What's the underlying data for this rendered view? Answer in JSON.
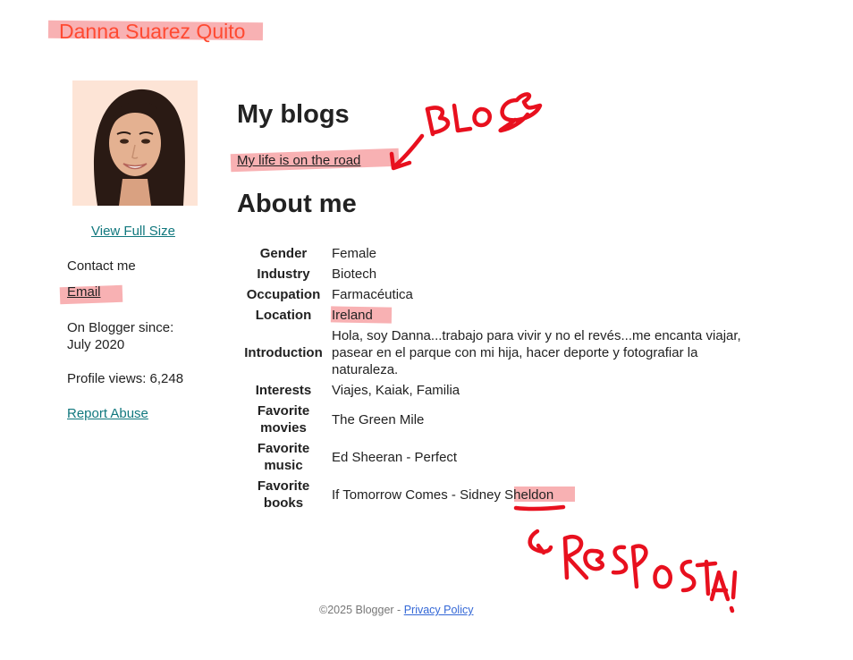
{
  "profile": {
    "name": "Danna Suarez Quito",
    "view_full_size": "View Full Size",
    "contact_label": "Contact me",
    "email_link": "Email",
    "blogger_since_line1": "On Blogger since:",
    "blogger_since_line2": "July 2020",
    "profile_views": "Profile views: 6,248",
    "report_abuse": "Report Abuse"
  },
  "blogs": {
    "heading": "My blogs",
    "items": [
      {
        "title": "My life is on the road"
      }
    ]
  },
  "about": {
    "heading": "About me",
    "rows": [
      {
        "label": "Gender",
        "value": "Female"
      },
      {
        "label": "Industry",
        "value": "Biotech"
      },
      {
        "label": "Occupation",
        "value": "Farmacéutica"
      },
      {
        "label": "Location",
        "value": "Ireland"
      },
      {
        "label": "Introduction",
        "value": "Hola, soy Danna...trabajo para vivir y no el revés...me encanta viajar, pasear en el parque con mi hija, hacer deporte y fotografiar la naturaleza."
      },
      {
        "label": "Interests",
        "value": "Viajes, Kaiak, Familia"
      },
      {
        "label": "Favorite movies",
        "value": "The Green Mile"
      },
      {
        "label": "Favorite music",
        "value": "Ed Sheeran - Perfect"
      },
      {
        "label": "Favorite books",
        "value_prefix": "If Tomorrow Comes - Sidney ",
        "value_highlight": "Sheldon"
      }
    ]
  },
  "footer": {
    "copyright": "©2025 Blogger - ",
    "privacy_policy": "Privacy Policy"
  },
  "annotations": {
    "blog_note": "BLOG",
    "answer_note": "RESPOSTA!",
    "highlight_color": "#f7a3a6",
    "ink_color": "#e8101e"
  },
  "colors": {
    "name_color": "#ff4a32",
    "link_teal": "#11787e",
    "footer_link": "#3367d6"
  }
}
